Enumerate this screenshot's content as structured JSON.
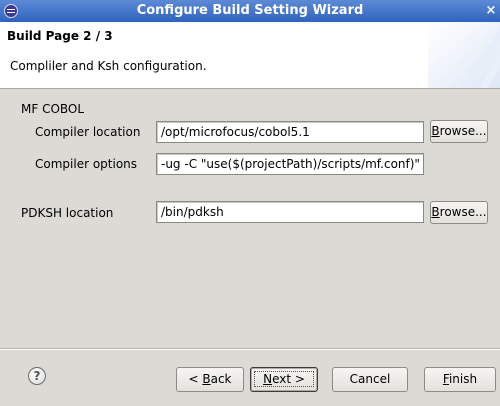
{
  "window": {
    "title": "Configure Build Setting Wizard",
    "close_glyph": "×"
  },
  "header": {
    "page_title": "Build Page 2 / 3",
    "description": "Compliler and Ksh configuration."
  },
  "section": {
    "label": "MF COBOL"
  },
  "fields": {
    "compiler_location": {
      "label": "Compiler location",
      "value": "/opt/microfocus/cobol5.1",
      "browse": {
        "pre": "",
        "mnemonic": "B",
        "post": "rowse..."
      }
    },
    "compiler_options": {
      "label": "Compiler options",
      "value": "-ug -C \"use($(projectPath)/scripts/mf.conf)\" -C \""
    },
    "pdksh_location": {
      "label": "PDKSH location",
      "value": "/bin/pdksh",
      "browse": {
        "pre": "",
        "mnemonic": "B",
        "post": "rowse..."
      }
    }
  },
  "footer": {
    "help_glyph": "?",
    "back": {
      "pre": "< ",
      "mnemonic": "B",
      "post": "ack"
    },
    "next": {
      "pre": "",
      "mnemonic": "N",
      "post": "ext >"
    },
    "cancel": {
      "label": "Cancel"
    },
    "finish": {
      "pre": "",
      "mnemonic": "F",
      "post": "inish"
    }
  }
}
